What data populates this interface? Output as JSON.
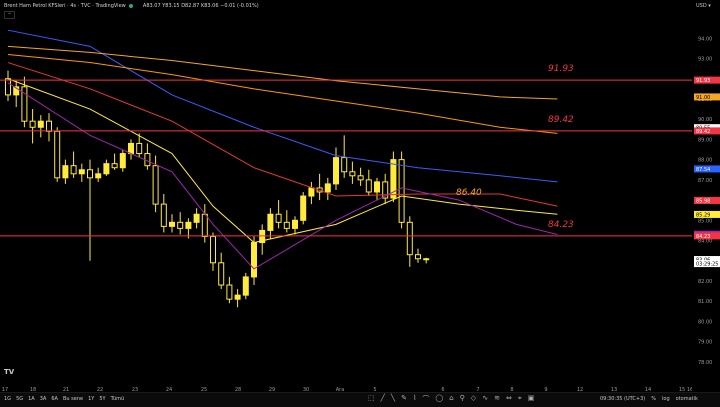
{
  "legend": {
    "title": "Brent Ham Petrol KFSleri · 4s · TVC · TradingView",
    "ohlc": "A83.07 Y83.15 D82.87 K83.06 −0.01 (-0.01%)"
  },
  "collapse_label": "^",
  "tv_logo": "TV",
  "price_axis": {
    "currency": "USD",
    "ticks": [
      "94.00",
      "93.00",
      "92.00",
      "91.00",
      "90.00",
      "89.00",
      "88.00",
      "87.00",
      "86.00",
      "85.00",
      "84.00",
      "83.00",
      "82.00",
      "81.00",
      "80.00",
      "79.00",
      "78.00"
    ],
    "badges": [
      {
        "text": "91.93",
        "price": 91.93,
        "bg": "#f23645",
        "fg": "#ffffff"
      },
      {
        "text": "91.00",
        "price": 91.1,
        "bg": "#f5a623",
        "fg": "#000000"
      },
      {
        "text": "89.55",
        "price": 89.58,
        "bg": "#ffffff",
        "fg": "#000000"
      },
      {
        "text": "89.42",
        "price": 89.42,
        "bg": "#f23645",
        "fg": "#ffffff"
      },
      {
        "text": "87.54",
        "price": 87.54,
        "bg": "#2962ff",
        "fg": "#ffffff"
      },
      {
        "text": "85.98",
        "price": 85.98,
        "bg": "#f23645",
        "fg": "#ffffff"
      },
      {
        "text": "85.29",
        "price": 85.29,
        "bg": "#ffeb3b",
        "fg": "#000000"
      },
      {
        "text": "84.31",
        "price": 84.31,
        "bg": "#9c27b0",
        "fg": "#ffffff"
      },
      {
        "text": "84.23",
        "price": 84.23,
        "bg": "#f23645",
        "fg": "#ffffff"
      },
      {
        "text": "83.06",
        "price": 83.06,
        "bg": "#ffffff",
        "fg": "#000000"
      },
      {
        "text": "03:29:25",
        "price": 82.86,
        "bg": "#ffffff",
        "fg": "#000000"
      }
    ]
  },
  "time_axis": [
    "17",
    "18",
    "21",
    "22",
    "23",
    "24",
    "25",
    "28",
    "29",
    "30",
    "Ara",
    "5",
    "6",
    "7",
    "8",
    "9",
    "12",
    "13",
    "14",
    "15",
    "16"
  ],
  "hlines": [
    {
      "price": 91.93,
      "label": "91.93",
      "color": "#f23645"
    },
    {
      "price": 89.42,
      "label": "89.42",
      "color": "#f23645"
    },
    {
      "price": 84.23,
      "label": "84.23",
      "color": "#f23645"
    }
  ],
  "annotation": {
    "label": "86.40",
    "price": 86.4,
    "color": "#f5a623"
  },
  "chart_data": {
    "type": "candlestick",
    "symbol": "Brent Ham Petrol KFSleri",
    "interval": "4s",
    "y_range": [
      77.5,
      95.2
    ],
    "candles": [
      [
        92.0,
        92.4,
        90.9,
        91.2
      ],
      [
        91.2,
        91.9,
        90.6,
        91.6
      ],
      [
        91.6,
        92.1,
        89.6,
        89.9
      ],
      [
        89.9,
        90.5,
        88.8,
        89.6
      ],
      [
        89.6,
        90.2,
        89.1,
        89.9
      ],
      [
        89.9,
        90.3,
        88.9,
        89.4
      ],
      [
        89.4,
        89.6,
        86.9,
        87.1
      ],
      [
        87.1,
        88.0,
        86.8,
        87.7
      ],
      [
        87.7,
        88.4,
        87.1,
        87.3
      ],
      [
        87.3,
        87.8,
        86.9,
        87.5
      ],
      [
        87.5,
        88.0,
        83.0,
        87.1
      ],
      [
        87.1,
        87.6,
        86.9,
        87.3
      ],
      [
        87.3,
        88.0,
        87.2,
        87.8
      ],
      [
        87.8,
        88.3,
        87.5,
        87.6
      ],
      [
        87.6,
        88.5,
        87.4,
        88.3
      ],
      [
        88.3,
        89.0,
        88.0,
        88.8
      ],
      [
        88.8,
        89.3,
        88.1,
        88.3
      ],
      [
        88.3,
        88.8,
        87.5,
        87.7
      ],
      [
        87.7,
        88.2,
        85.4,
        85.8
      ],
      [
        85.8,
        86.3,
        84.4,
        84.7
      ],
      [
        84.7,
        85.3,
        84.4,
        84.9
      ],
      [
        84.9,
        85.4,
        84.3,
        84.6
      ],
      [
        84.6,
        85.1,
        84.1,
        84.9
      ],
      [
        84.9,
        85.6,
        84.6,
        85.3
      ],
      [
        85.3,
        85.8,
        83.9,
        84.2
      ],
      [
        84.2,
        84.4,
        82.5,
        82.9
      ],
      [
        82.9,
        83.4,
        81.6,
        81.8
      ],
      [
        81.8,
        82.2,
        80.9,
        81.1
      ],
      [
        81.1,
        81.6,
        80.7,
        81.3
      ],
      [
        81.3,
        82.4,
        81.1,
        82.2
      ],
      [
        82.2,
        84.2,
        81.8,
        83.9
      ],
      [
        83.9,
        84.8,
        83.3,
        84.5
      ],
      [
        84.5,
        85.6,
        84.1,
        85.3
      ],
      [
        85.3,
        86.0,
        84.6,
        84.9
      ],
      [
        84.9,
        85.5,
        84.4,
        84.6
      ],
      [
        84.6,
        85.2,
        84.3,
        85.0
      ],
      [
        85.0,
        86.4,
        84.8,
        86.2
      ],
      [
        86.2,
        86.9,
        85.8,
        86.6
      ],
      [
        86.6,
        87.3,
        86.0,
        86.4
      ],
      [
        86.4,
        87.1,
        86.0,
        86.8
      ],
      [
        86.8,
        88.6,
        86.5,
        88.1
      ],
      [
        88.1,
        89.2,
        87.1,
        87.4
      ],
      [
        87.4,
        87.9,
        86.8,
        87.2
      ],
      [
        87.2,
        87.6,
        86.7,
        87.0
      ],
      [
        87.0,
        87.5,
        86.2,
        86.4
      ],
      [
        86.4,
        87.1,
        86.0,
        86.9
      ],
      [
        86.9,
        87.3,
        85.8,
        86.1
      ],
      [
        86.1,
        88.4,
        85.9,
        88.0
      ],
      [
        88.0,
        88.4,
        84.6,
        84.9
      ],
      [
        84.9,
        85.2,
        82.7,
        83.3
      ],
      [
        83.3,
        83.6,
        82.9,
        83.1
      ],
      [
        83.1,
        83.15,
        82.87,
        83.06
      ]
    ],
    "lines": [
      {
        "name": "ma-blue",
        "color": "#3d5afe",
        "points": [
          [
            0,
            94.4
          ],
          [
            10,
            93.6
          ],
          [
            20,
            91.2
          ],
          [
            30,
            89.6
          ],
          [
            40,
            88.2
          ],
          [
            50,
            87.6
          ],
          [
            60,
            87.2
          ],
          [
            67,
            86.9
          ]
        ]
      },
      {
        "name": "ma-orange",
        "color": "#ff9800",
        "points": [
          [
            0,
            93.2
          ],
          [
            10,
            92.8
          ],
          [
            20,
            92.2
          ],
          [
            30,
            91.5
          ],
          [
            40,
            90.9
          ],
          [
            50,
            90.3
          ],
          [
            60,
            89.6
          ],
          [
            67,
            89.3
          ]
        ]
      },
      {
        "name": "ma-gold",
        "color": "#f5a623",
        "points": [
          [
            0,
            93.6
          ],
          [
            10,
            93.3
          ],
          [
            20,
            92.9
          ],
          [
            30,
            92.4
          ],
          [
            40,
            91.9
          ],
          [
            50,
            91.5
          ],
          [
            60,
            91.1
          ],
          [
            67,
            91.0
          ]
        ]
      },
      {
        "name": "ma-red",
        "color": "#e53935",
        "points": [
          [
            0,
            92.8
          ],
          [
            10,
            91.5
          ],
          [
            20,
            89.9
          ],
          [
            30,
            87.6
          ],
          [
            40,
            86.2
          ],
          [
            50,
            86.3
          ],
          [
            60,
            86.3
          ],
          [
            67,
            85.7
          ]
        ]
      },
      {
        "name": "ma-yellow",
        "color": "#ffeb3b",
        "points": [
          [
            0,
            92.0
          ],
          [
            10,
            90.5
          ],
          [
            20,
            88.3
          ],
          [
            25,
            85.7
          ],
          [
            30,
            83.9
          ],
          [
            40,
            84.8
          ],
          [
            48,
            86.2
          ],
          [
            55,
            85.8
          ],
          [
            62,
            85.5
          ],
          [
            67,
            85.3
          ]
        ]
      },
      {
        "name": "ma-purple",
        "color": "#9c27b0",
        "points": [
          [
            0,
            91.8
          ],
          [
            10,
            89.2
          ],
          [
            20,
            87.4
          ],
          [
            25,
            84.8
          ],
          [
            30,
            82.6
          ],
          [
            40,
            85.0
          ],
          [
            48,
            86.6
          ],
          [
            55,
            86.0
          ],
          [
            62,
            84.8
          ],
          [
            67,
            84.3
          ]
        ]
      }
    ]
  },
  "bottom_bar": {
    "ranges": [
      "1G",
      "5G",
      "1A",
      "3A",
      "6A",
      "Bu sene",
      "1Y",
      "5Y",
      "Tümü"
    ],
    "tools": [
      "⬚",
      "╱",
      "╲",
      "✎",
      "⌇",
      "⌒",
      "◯",
      "⌂",
      "⚲",
      "◇",
      "∿",
      "≋",
      "⇔",
      "⌖",
      "▣"
    ],
    "time": "09:30:35 (UTC+3)",
    "percent": "%",
    "log": "log",
    "auto": "otomatik"
  }
}
